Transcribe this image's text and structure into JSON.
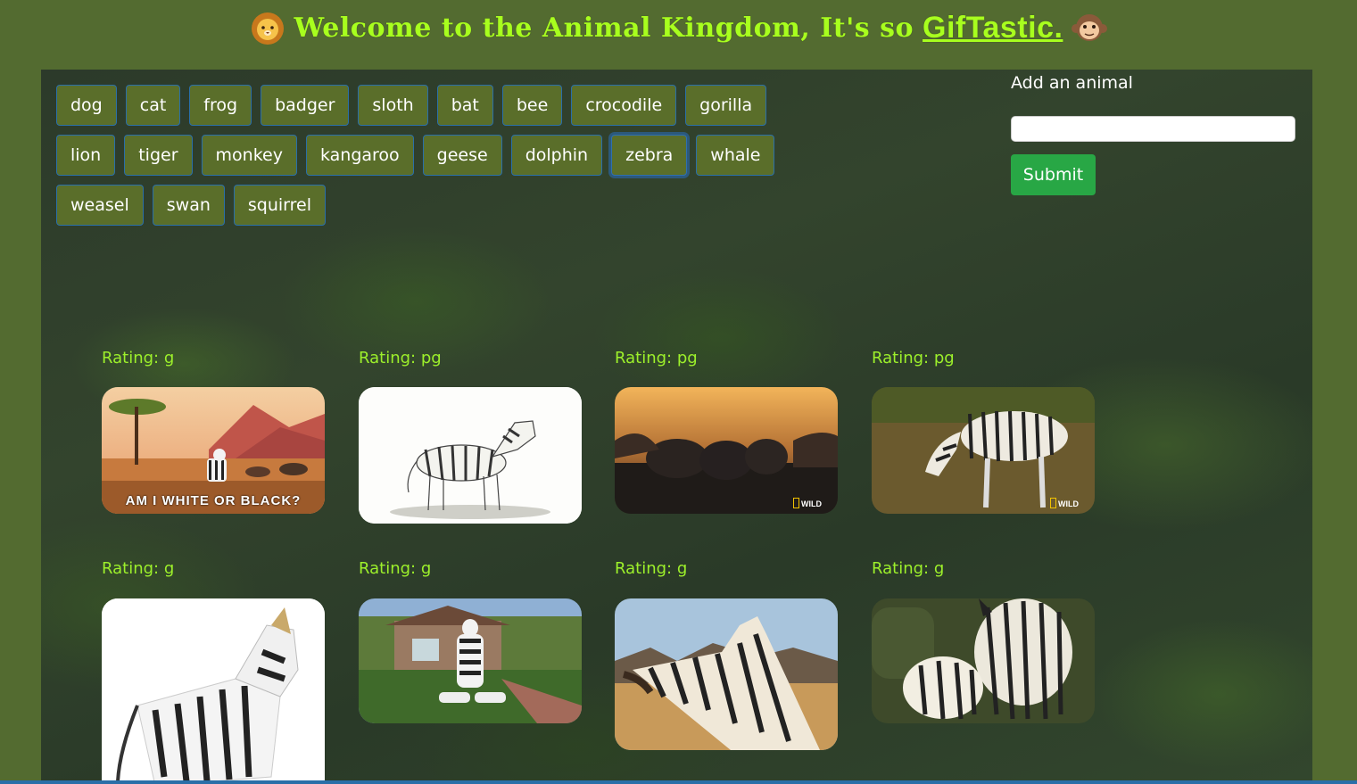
{
  "header": {
    "title_text": "Welcome to the Animal Kingdom, It's so",
    "title_link": "GifTastic.",
    "left_icon": "lion-face-emoji",
    "right_icon": "monkey-face-emoji"
  },
  "animals": {
    "rows": [
      [
        "dog",
        "cat",
        "frog",
        "badger",
        "sloth",
        "bat",
        "bee",
        "crocodile",
        "gorilla"
      ],
      [
        "lion",
        "tiger",
        "monkey",
        "kangaroo",
        "geese",
        "dolphin",
        "zebra",
        "whale"
      ],
      [
        "weasel",
        "swan",
        "squirrel"
      ]
    ],
    "active": "zebra"
  },
  "form": {
    "label": "Add an animal",
    "input_value": "",
    "submit_label": "Submit"
  },
  "gifs": [
    {
      "rating": "Rating: g",
      "caption": "AM I WHITE OR BLACK?",
      "watermark": ""
    },
    {
      "rating": "Rating: pg",
      "caption": "",
      "watermark": ""
    },
    {
      "rating": "Rating: pg",
      "caption": "",
      "watermark": "WILD"
    },
    {
      "rating": "Rating: pg",
      "caption": "",
      "watermark": "WILD"
    },
    {
      "rating": "Rating: g",
      "caption": "",
      "watermark": ""
    },
    {
      "rating": "Rating: g",
      "caption": "",
      "watermark": ""
    },
    {
      "rating": "Rating: g",
      "caption": "",
      "watermark": ""
    },
    {
      "rating": "Rating: g",
      "caption": "",
      "watermark": ""
    }
  ],
  "colors": {
    "page_bg": "#536b30",
    "title": "#a8ff1e",
    "rating": "#9df02b",
    "button_bg": "#5a6e2a",
    "button_border": "#2a6fa8",
    "submit": "#28a745"
  }
}
